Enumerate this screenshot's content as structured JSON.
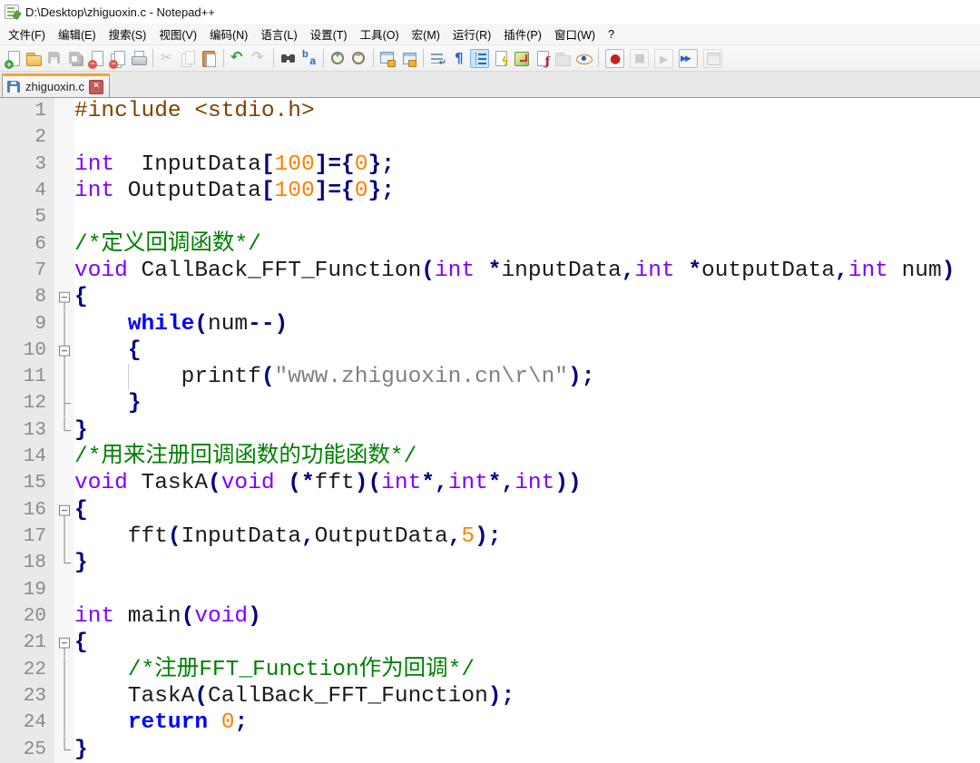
{
  "window": {
    "title": "D:\\Desktop\\zhiguoxin.c - Notepad++"
  },
  "menu": {
    "items": [
      {
        "key": "file",
        "label": "文件(F)"
      },
      {
        "key": "edit",
        "label": "编辑(E)"
      },
      {
        "key": "search",
        "label": "搜索(S)"
      },
      {
        "key": "view",
        "label": "视图(V)"
      },
      {
        "key": "encoding",
        "label": "编码(N)"
      },
      {
        "key": "language",
        "label": "语言(L)"
      },
      {
        "key": "settings",
        "label": "设置(T)"
      },
      {
        "key": "tools",
        "label": "工具(O)"
      },
      {
        "key": "macro",
        "label": "宏(M)"
      },
      {
        "key": "run",
        "label": "运行(R)"
      },
      {
        "key": "plugins",
        "label": "插件(P)"
      },
      {
        "key": "window",
        "label": "窗口(W)"
      },
      {
        "key": "help",
        "label": "?"
      }
    ]
  },
  "toolbar": {
    "items": [
      {
        "name": "new-file"
      },
      {
        "name": "open"
      },
      {
        "name": "save",
        "disabled": true
      },
      {
        "name": "save-all",
        "disabled": true
      },
      {
        "name": "close"
      },
      {
        "name": "close-all"
      },
      {
        "name": "print"
      },
      {
        "sep": true
      },
      {
        "name": "cut",
        "disabled": true
      },
      {
        "name": "copy",
        "disabled": true
      },
      {
        "name": "paste"
      },
      {
        "sep": true
      },
      {
        "name": "undo"
      },
      {
        "name": "redo",
        "disabled": true
      },
      {
        "sep": true
      },
      {
        "name": "find"
      },
      {
        "name": "replace"
      },
      {
        "sep": true
      },
      {
        "name": "zoom-in"
      },
      {
        "name": "zoom-out"
      },
      {
        "sep": true
      },
      {
        "name": "sync-v"
      },
      {
        "name": "sync-h"
      },
      {
        "sep": true
      },
      {
        "name": "word-wrap"
      },
      {
        "name": "show-all-chars"
      },
      {
        "name": "indent-guide",
        "active": true
      },
      {
        "name": "define-language"
      },
      {
        "name": "doc-map"
      },
      {
        "name": "function-list"
      },
      {
        "name": "folder-workspace",
        "disabled": true
      },
      {
        "name": "monitoring"
      },
      {
        "sep": true
      },
      {
        "name": "macro-record",
        "boxed": true
      },
      {
        "name": "macro-stop",
        "boxed": true,
        "disabled": true
      },
      {
        "name": "macro-play",
        "boxed": true,
        "disabled": true
      },
      {
        "name": "macro-run-multiple",
        "boxed": true
      },
      {
        "name": "macro-save",
        "boxed": true,
        "disabled": true
      }
    ]
  },
  "tabbar": {
    "tabs": [
      {
        "label": "zhiguoxin.c",
        "active": true,
        "saved": true,
        "close_glyph": "×"
      }
    ]
  },
  "colors": {
    "active_tab_accent": "#f7a234",
    "preprocessor": "#804000",
    "type_keyword": "#8000ff",
    "instruction_keyword": "#0000ff",
    "number": "#ff8000",
    "operator": "#000080",
    "string": "#808080",
    "comment": "#008000",
    "line_number": "#8a8a8a"
  },
  "editor": {
    "lines": [
      {
        "n": 1,
        "fold": "",
        "segs": [
          [
            "pre",
            "#include <stdio.h>"
          ]
        ]
      },
      {
        "n": 2,
        "fold": "",
        "segs": []
      },
      {
        "n": 3,
        "fold": "",
        "segs": [
          [
            "type",
            "int"
          ],
          [
            "id",
            "  InputData"
          ],
          [
            "op",
            "["
          ],
          [
            "num",
            "100"
          ],
          [
            "op",
            "]={"
          ],
          [
            "num",
            "0"
          ],
          [
            "op",
            "};"
          ]
        ]
      },
      {
        "n": 4,
        "fold": "",
        "segs": [
          [
            "type",
            "int"
          ],
          [
            "id",
            " OutputData"
          ],
          [
            "op",
            "["
          ],
          [
            "num",
            "100"
          ],
          [
            "op",
            "]={"
          ],
          [
            "num",
            "0"
          ],
          [
            "op",
            "};"
          ]
        ]
      },
      {
        "n": 5,
        "fold": "",
        "segs": []
      },
      {
        "n": 6,
        "fold": "",
        "segs": [
          [
            "cmt",
            "/*定义回调函数*/"
          ]
        ]
      },
      {
        "n": 7,
        "fold": "",
        "segs": [
          [
            "type",
            "void"
          ],
          [
            "id",
            " CallBack_FFT_Function"
          ],
          [
            "op",
            "("
          ],
          [
            "type",
            "int"
          ],
          [
            "id",
            " "
          ],
          [
            "op",
            "*"
          ],
          [
            "id",
            "inputData"
          ],
          [
            "op",
            ","
          ],
          [
            "type",
            "int"
          ],
          [
            "id",
            " "
          ],
          [
            "op",
            "*"
          ],
          [
            "id",
            "outputData"
          ],
          [
            "op",
            ","
          ],
          [
            "type",
            "int"
          ],
          [
            "id",
            " num"
          ],
          [
            "op",
            ")"
          ]
        ]
      },
      {
        "n": 8,
        "fold": "start",
        "segs": [
          [
            "op",
            "{"
          ]
        ]
      },
      {
        "n": 9,
        "fold": "mid",
        "segs": [
          [
            "id",
            "    "
          ],
          [
            "kw",
            "while"
          ],
          [
            "op",
            "("
          ],
          [
            "id",
            "num"
          ],
          [
            "op",
            "--)"
          ]
        ]
      },
      {
        "n": 10,
        "fold": "start2",
        "segs": [
          [
            "id",
            "    "
          ],
          [
            "op",
            "{"
          ]
        ]
      },
      {
        "n": 11,
        "fold": "mid",
        "guides": [
          4
        ],
        "segs": [
          [
            "id",
            "        printf"
          ],
          [
            "op",
            "("
          ],
          [
            "str",
            "\"www.zhiguoxin.cn\\r\\n\""
          ],
          [
            "op",
            ");"
          ]
        ]
      },
      {
        "n": 12,
        "fold": "subend",
        "segs": [
          [
            "id",
            "    "
          ],
          [
            "op",
            "}"
          ]
        ]
      },
      {
        "n": 13,
        "fold": "end",
        "segs": [
          [
            "op",
            "}"
          ]
        ]
      },
      {
        "n": 14,
        "fold": "",
        "segs": [
          [
            "cmt",
            "/*用来注册回调函数的功能函数*/"
          ]
        ]
      },
      {
        "n": 15,
        "fold": "",
        "segs": [
          [
            "type",
            "void"
          ],
          [
            "id",
            " TaskA"
          ],
          [
            "op",
            "("
          ],
          [
            "type",
            "void"
          ],
          [
            "id",
            " "
          ],
          [
            "op",
            "(*"
          ],
          [
            "id",
            "fft"
          ],
          [
            "op",
            ")("
          ],
          [
            "type",
            "int"
          ],
          [
            "op",
            "*,"
          ],
          [
            "type",
            "int"
          ],
          [
            "op",
            "*,"
          ],
          [
            "type",
            "int"
          ],
          [
            "op",
            "))"
          ]
        ]
      },
      {
        "n": 16,
        "fold": "start",
        "segs": [
          [
            "op",
            "{"
          ]
        ]
      },
      {
        "n": 17,
        "fold": "mid",
        "segs": [
          [
            "id",
            "    fft"
          ],
          [
            "op",
            "("
          ],
          [
            "id",
            "InputData"
          ],
          [
            "op",
            ","
          ],
          [
            "id",
            "OutputData"
          ],
          [
            "op",
            ","
          ],
          [
            "num",
            "5"
          ],
          [
            "op",
            ");"
          ]
        ]
      },
      {
        "n": 18,
        "fold": "end",
        "segs": [
          [
            "op",
            "}"
          ]
        ]
      },
      {
        "n": 19,
        "fold": "",
        "segs": []
      },
      {
        "n": 20,
        "fold": "",
        "segs": [
          [
            "type",
            "int"
          ],
          [
            "id",
            " main"
          ],
          [
            "op",
            "("
          ],
          [
            "type",
            "void"
          ],
          [
            "op",
            ")"
          ]
        ]
      },
      {
        "n": 21,
        "fold": "start",
        "segs": [
          [
            "op",
            "{"
          ]
        ]
      },
      {
        "n": 22,
        "fold": "mid",
        "segs": [
          [
            "id",
            "    "
          ],
          [
            "cmt",
            "/*注册FFT_Function作为回调*/"
          ]
        ]
      },
      {
        "n": 23,
        "fold": "mid",
        "segs": [
          [
            "id",
            "    TaskA"
          ],
          [
            "op",
            "("
          ],
          [
            "id",
            "CallBack_FFT_Function"
          ],
          [
            "op",
            ");"
          ]
        ]
      },
      {
        "n": 24,
        "fold": "mid",
        "segs": [
          [
            "id",
            "    "
          ],
          [
            "kw",
            "return"
          ],
          [
            "id",
            " "
          ],
          [
            "num",
            "0"
          ],
          [
            "op",
            ";"
          ]
        ]
      },
      {
        "n": 25,
        "fold": "end",
        "segs": [
          [
            "op",
            "}"
          ]
        ]
      }
    ]
  }
}
